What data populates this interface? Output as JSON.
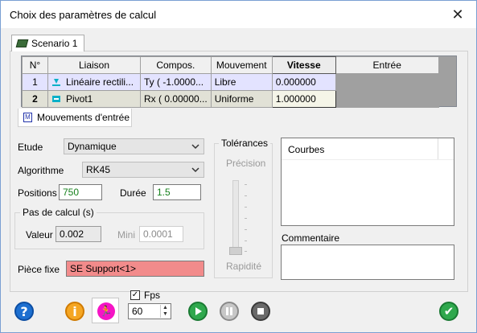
{
  "window": {
    "title": "Choix des paramètres de calcul"
  },
  "tab": {
    "label": "Scenario 1"
  },
  "table": {
    "headers": [
      "N°",
      "Liaison",
      "Compos.",
      "Mouvement",
      "Vitesse",
      "Entrée"
    ],
    "rows": [
      {
        "n": "1",
        "liaison": "Linéaire rectili...",
        "compos": "Ty ( -1.0000...",
        "mouvement": "Libre",
        "vitesse": "0.000000",
        "entree": ""
      },
      {
        "n": "2",
        "liaison": "Pivot1",
        "compos": "Rx ( 0.00000...",
        "mouvement": "Uniforme",
        "vitesse": "1.000000",
        "entree": ""
      }
    ]
  },
  "mouvements_tab": {
    "label": "Mouvements d'entrée"
  },
  "form": {
    "etude_label": "Etude",
    "etude_value": "Dynamique",
    "algorithme_label": "Algorithme",
    "algorithme_value": "RK45",
    "positions_label": "Positions",
    "positions_value": "750",
    "duree_label": "Durée",
    "duree_value": "1.5",
    "pas_label": "Pas de calcul (s)",
    "valeur_label": "Valeur",
    "valeur_value": "0.002",
    "mini_label": "Mini",
    "mini_value": "0.0001",
    "piece_label": "Pièce fixe",
    "piece_value": "SE Support<1>"
  },
  "tolerances": {
    "title": "Tolérances",
    "precision": "Précision",
    "rapidite": "Rapidité"
  },
  "courbes": {
    "label": "Courbes"
  },
  "commentaire": {
    "label": "Commentaire"
  },
  "toolbar": {
    "fps_label": "Fps",
    "fps_checked": true,
    "fps_value": "60"
  },
  "icons": [
    "table-icon",
    "link-icon",
    "pivot-icon",
    "m-icon",
    "help-icon",
    "info-icon",
    "runner-icon",
    "play-icon",
    "pause-icon",
    "stop-icon",
    "ok-icon",
    "close-icon"
  ]
}
